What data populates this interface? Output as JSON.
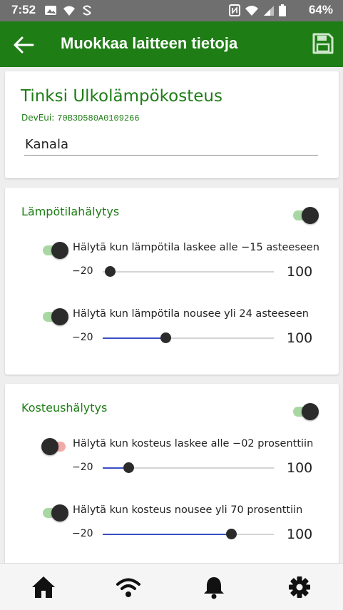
{
  "status_bar": {
    "time": "7:52",
    "battery": "64%",
    "icons": [
      "photo-notification-icon",
      "wifi-notification-icon",
      "sync-notification-icon",
      "nfc-icon",
      "wifi-signal-icon",
      "cell-signal-icon",
      "battery-icon"
    ]
  },
  "app_bar": {
    "title": "Muokkaa laitteen tietoja",
    "back_icon": "arrow-back-icon",
    "save_icon": "save-icon",
    "color": "#1e7d15"
  },
  "device": {
    "name": "Tinksi Ulkolämpökosteus",
    "deveui_label": "DevEui:",
    "deveui": "70B3D580A0109266",
    "location": "Kanala"
  },
  "temperature": {
    "title": "Lämpötilahälytys",
    "enabled": true,
    "alarms": [
      {
        "label": "Hälytä kun lämpötila laskee alle −15 asteeseen",
        "enabled": true,
        "min": "−20",
        "max": "100",
        "value": -15,
        "range": [
          -20,
          100
        ],
        "filled": false
      },
      {
        "label": "Hälytä kun lämpötila nousee yli 24 asteeseen",
        "enabled": true,
        "min": "−20",
        "max": "100",
        "value": 24,
        "range": [
          -20,
          100
        ],
        "filled": true
      }
    ]
  },
  "humidity": {
    "title": "Kosteushälytys",
    "enabled": true,
    "alarms": [
      {
        "label": "Hälytä kun kosteus laskee alle −02 prosenttiin",
        "enabled": false,
        "min": "−20",
        "max": "100",
        "value": -2,
        "range": [
          -20,
          100
        ],
        "filled": true
      },
      {
        "label": "Hälytä kun kosteus nousee yli 70 prosenttiin",
        "enabled": true,
        "min": "−20",
        "max": "100",
        "value": 70,
        "range": [
          -20,
          100
        ],
        "filled": true
      }
    ]
  },
  "bottom_nav": {
    "items": [
      "home-icon",
      "wifi-icon",
      "bell-icon",
      "gear-icon"
    ]
  },
  "colors": {
    "accent": "#1e7d15",
    "slider_fill": "#3a4fc4",
    "toggle_on_track": "#a9d7a4",
    "toggle_off_track": "#f1aaa8"
  }
}
